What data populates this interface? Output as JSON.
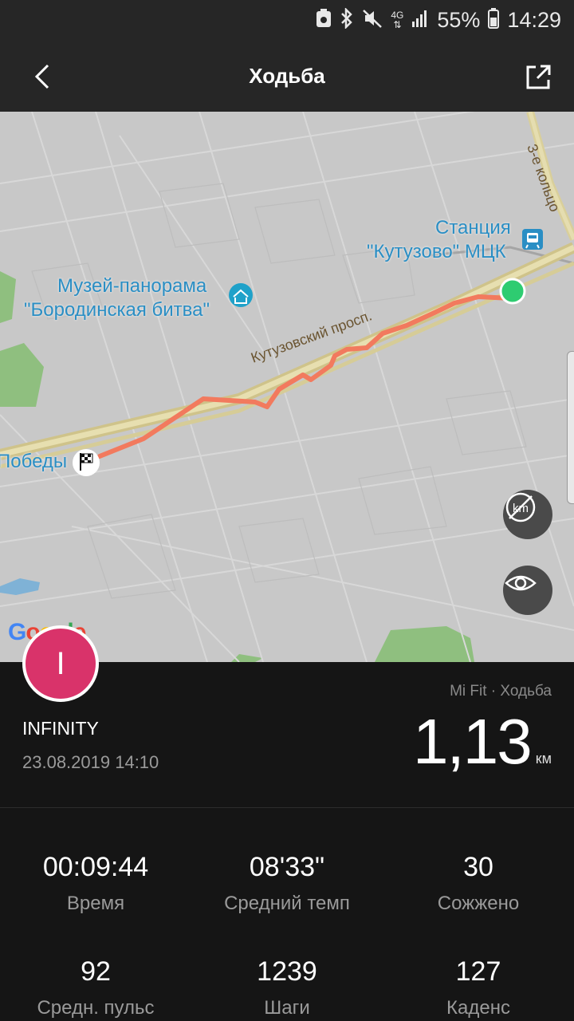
{
  "status": {
    "network": "4G",
    "battery": "55%",
    "time": "14:29"
  },
  "header": {
    "title": "Ходьба"
  },
  "map": {
    "poi_museum_line1": "Музей-панорама",
    "poi_museum_line2": "\"Бородинская битва\"",
    "poi_station_line1": "Станция",
    "poi_station_line2": "\"Кутузово\" МЦК",
    "street_kutuzovsky": "Кутузовский просп.",
    "street_ring": "3-е кольцо",
    "street_pobedy": "Победы",
    "attribution": "Google",
    "units_toggle_label": "km",
    "colors": {
      "route": "#f27a5e",
      "start_marker": "#2ecc71"
    }
  },
  "workout": {
    "avatar_initial": "I",
    "source": "Mi Fit · Ходьба",
    "user": "INFINITY",
    "datetime": "23.08.2019 14:10",
    "distance": "1,13",
    "distance_unit": "км"
  },
  "stats": [
    {
      "value": "00:09:44",
      "label": "Время"
    },
    {
      "value": "08'33\"",
      "label": "Средний темп"
    },
    {
      "value": "30",
      "label": "Сожжено"
    },
    {
      "value": "92",
      "label": "Средн. пульс"
    },
    {
      "value": "1239",
      "label": "Шаги"
    },
    {
      "value": "127",
      "label": "Каденс"
    }
  ]
}
